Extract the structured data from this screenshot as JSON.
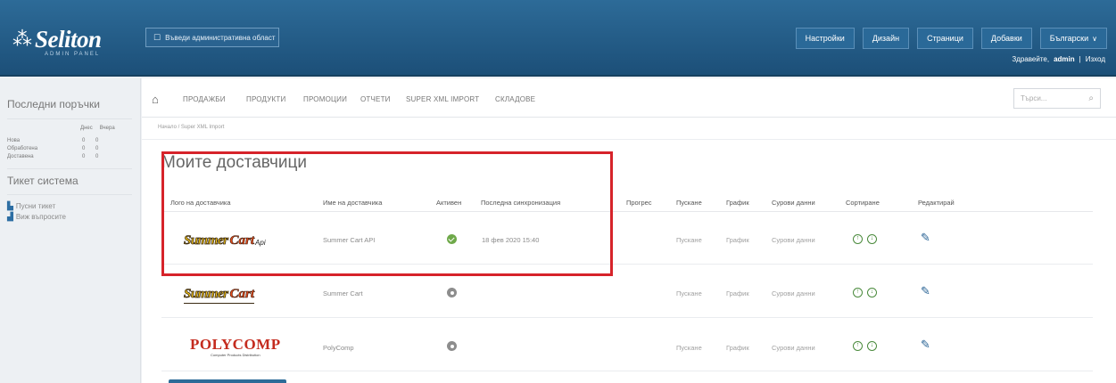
{
  "header": {
    "logo_text": "Seliton",
    "logo_subtitle": "ADMIN PANEL",
    "region_button": "Въведи административна област",
    "nav_buttons": [
      "Настройки",
      "Дизайн",
      "Страници",
      "Добавки",
      "Български"
    ],
    "greeting": "Здравейте,",
    "username": "admin",
    "separator": "|",
    "logout": "Изход"
  },
  "sidebar": {
    "orders_title": "Последни поръчки",
    "orders_columns": [
      "Днес",
      "Вчера"
    ],
    "orders_rows": [
      {
        "label": "Нова",
        "today": "0",
        "yesterday": "0"
      },
      {
        "label": "Обработена",
        "today": "0",
        "yesterday": "0"
      },
      {
        "label": "Доставена",
        "today": "0",
        "yesterday": "0"
      }
    ],
    "ticket_title": "Тикет система",
    "ticket_links": [
      "Пусни тикет",
      "Виж въпросите"
    ]
  },
  "menu": {
    "items": [
      "ПРОДАЖБИ",
      "ПРОДУКТИ",
      "ПРОМОЦИИ",
      "ОТЧЕТИ",
      "SUPER XML IMPORT",
      "СКЛАДОВЕ"
    ],
    "search_placeholder": "Търси..."
  },
  "breadcrumb": "Начало / Super XML Import",
  "page": {
    "title": "Моите доставчици",
    "columns": [
      "Лого на доставчика",
      "Име на доставчика",
      "Активен",
      "Последна синхронизация",
      "Прогрес",
      "Пускане",
      "График",
      "Сурови данни",
      "Сортиране",
      "Редактирай"
    ]
  },
  "suppliers": [
    {
      "logo": "summer-cart-api",
      "name": "Summer Cart API",
      "active": true,
      "last_sync": "18 фев 2020 15:40",
      "progress": "",
      "run": "Пускане",
      "schedule": "График",
      "raw": "Сурови данни"
    },
    {
      "logo": "summer-cart",
      "name": "Summer Cart",
      "active": false,
      "last_sync": "",
      "progress": "",
      "run": "Пускане",
      "schedule": "График",
      "raw": "Сурови данни"
    },
    {
      "logo": "polycomp",
      "name": "PolyComp",
      "active": false,
      "last_sync": "",
      "progress": "",
      "run": "Пускане",
      "schedule": "График",
      "raw": "Сурови данни"
    }
  ],
  "logos": {
    "summer": "Summer",
    "cart": "Cart",
    "api": "Api",
    "polycomp": "POLYCOMP",
    "polycomp_tagline": "Computer Products Distribution"
  },
  "colors": {
    "header_blue": "#1c4f78",
    "highlight_red": "#d6232a",
    "active_green": "#6fa94a",
    "inactive_grey": "#8d8d8d",
    "edit_blue": "#1f5c90"
  },
  "icons": {
    "home": "home-icon",
    "search": "search-icon",
    "edit": "pencil-icon",
    "sort_up": "arrow-up-circle-icon",
    "sort_down": "arrow-down-circle-icon"
  }
}
